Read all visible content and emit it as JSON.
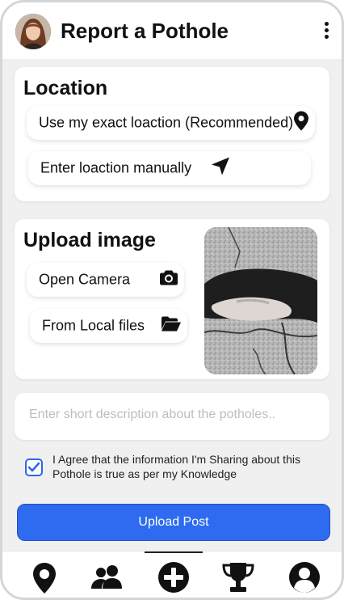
{
  "header": {
    "title": "Report a Pothole",
    "avatar_icon": "user-avatar-photo",
    "menu_icon": "more-vertical-icon"
  },
  "location": {
    "title": "Location",
    "use_exact_label": "Use my exact loaction (Recommended)",
    "use_exact_icon": "map-pin-icon",
    "manual_label": "Enter loaction manually",
    "manual_icon": "location-arrow-icon"
  },
  "upload": {
    "title": "Upload image",
    "camera_label": "Open Camera",
    "camera_icon": "camera-icon",
    "local_label": "From Local files",
    "local_icon": "folder-open-icon",
    "preview_image": "pothole-photo"
  },
  "description": {
    "placeholder": "Enter short description about the potholes.."
  },
  "agreement": {
    "checked": true,
    "text": "I Agree that the information I'm Sharing about this Pothole is true as per my Knowledge"
  },
  "submit": {
    "label": "Upload Post"
  },
  "bottom_nav": {
    "items": [
      "map-pin-icon",
      "users-icon",
      "plus-circle-icon",
      "trophy-icon",
      "user-circle-icon"
    ],
    "active_index": 2
  },
  "colors": {
    "accent": "#2e6bf0",
    "background": "#f0f0f0",
    "card": "#ffffff"
  }
}
